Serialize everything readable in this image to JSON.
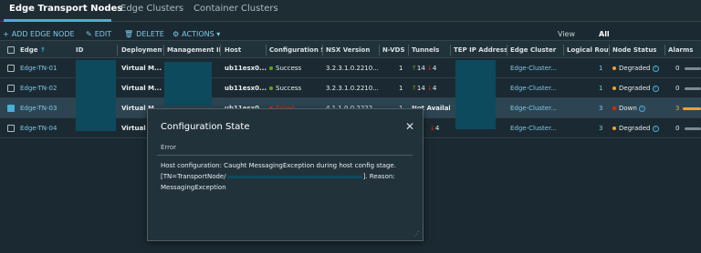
{
  "tabs": [
    {
      "label": "Edge Transport Nodes",
      "active": true
    },
    {
      "label": "Edge Clusters",
      "active": false
    },
    {
      "label": "Container Clusters",
      "active": false
    }
  ],
  "toolbar": {
    "add_label": "ADD EDGE NODE",
    "edit_label": "EDIT",
    "delete_label": "DELETE",
    "actions_label": "ACTIONS",
    "view_label": "View",
    "view_value": "All"
  },
  "columns": [
    "Edge",
    "ID",
    "Deployment T",
    "Management IP",
    "Host",
    "Configuration Sta",
    "NSX Version",
    "N-VDS",
    "Tunnels",
    "TEP IP Addresses",
    "Edge Cluster",
    "Logical Route",
    "Node Status",
    "Alarms"
  ],
  "sort_indicator": "↑",
  "rows": [
    {
      "edge": "Edge-TN-01",
      "deployment": "Virtual M...",
      "host": "ub11esx0...",
      "config_state": "Success",
      "config_color": "#62a420",
      "nsx_version": "3.2.3.1.0.2210...",
      "nvds": "1",
      "tunnels_up": "14",
      "tunnels_down": "4",
      "edge_cluster": "Edge-Cluster...",
      "logical_routers": "1",
      "node_status": "Degraded",
      "status_color": "#f0a030",
      "alarms": "0"
    },
    {
      "edge": "Edge-TN-02",
      "deployment": "Virtual M...",
      "host": "ub11esx0...",
      "config_state": "Success",
      "config_color": "#62a420",
      "nsx_version": "3.2.3.1.0.2210...",
      "nvds": "1",
      "tunnels_up": "14",
      "tunnels_down": "4",
      "edge_cluster": "Edge-Cluster...",
      "logical_routers": "1",
      "node_status": "Degraded",
      "status_color": "#f0a030",
      "alarms": "0"
    },
    {
      "edge": "Edge-TN-03",
      "deployment": "Virtual M...",
      "host": "ub11esx0...",
      "config_state": "Failed",
      "config_color": "#e62700",
      "nsx_version": "4.1.1.0.0.2222...",
      "nvds": "1",
      "tunnels_text": "Not Availab",
      "edge_cluster": "Edge-Cluster...",
      "logical_routers": "3",
      "node_status": "Down",
      "status_color": "#e62700",
      "alarms": "3"
    },
    {
      "edge": "Edge-TN-04",
      "deployment": "Virtual M",
      "host": "",
      "config_state": "",
      "nsx_version": "",
      "nvds": "",
      "tunnels_down": "4",
      "edge_cluster": "Edge-Cluster...",
      "logical_routers": "3",
      "node_status": "Degraded",
      "status_color": "#f0a030",
      "alarms": "0"
    }
  ],
  "dialog": {
    "title": "Configuration State",
    "close_glyph": "✕",
    "section_label": "Error",
    "line1": "Host configuration: Caught MessagingException during host config stage.",
    "line2_prefix": "[TN=TransportNode/",
    "line2_suffix": "]. Reason:",
    "line3": "MessagingException"
  },
  "colors": {
    "accent": "#49afd9",
    "link": "#7fc7e6",
    "success": "#62a420",
    "failed": "#e62700",
    "degraded": "#f0a030"
  }
}
